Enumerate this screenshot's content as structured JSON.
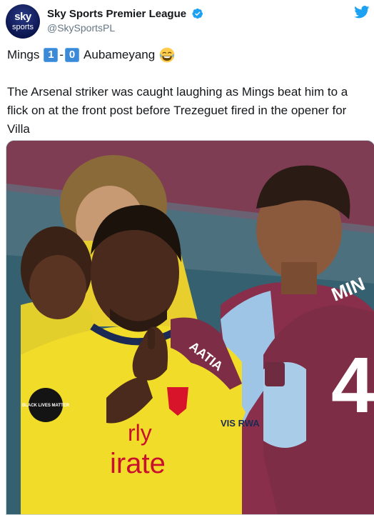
{
  "tweet": {
    "display_name": "Sky Sports Premier League",
    "handle": "@SkySportsPL",
    "avatar_text_top": "sky",
    "avatar_text_bottom": "sports",
    "headline": {
      "left_name": "Mings",
      "left_score": "1",
      "separator": "-",
      "right_score": "0",
      "right_name": "Aubameyang"
    },
    "body": "The Arsenal striker was caught laughing as Mings beat him to a flick on at the front post before Trezeguet fired in the opener for Villa"
  },
  "photo": {
    "shirt_name_back": "MIN",
    "shirt_number_back": "4",
    "shirt_name_left": "AATIA",
    "badge_text": "BLACK LIVES MATTER",
    "sponsor": "irate",
    "sponsor_prefix": "rly",
    "visit_text": "VIS\nRWA"
  },
  "colors": {
    "verified_blue": "#1da1f2",
    "key_blue": "#3a8ad8",
    "arsenal_yellow": "#f2dc2a",
    "villa_claret": "#7d2d45",
    "villa_sky_blue": "#9ec5e6"
  },
  "icons": [
    "verified-badge-icon",
    "twitter-bird-icon",
    "laughing-emoji-icon"
  ]
}
